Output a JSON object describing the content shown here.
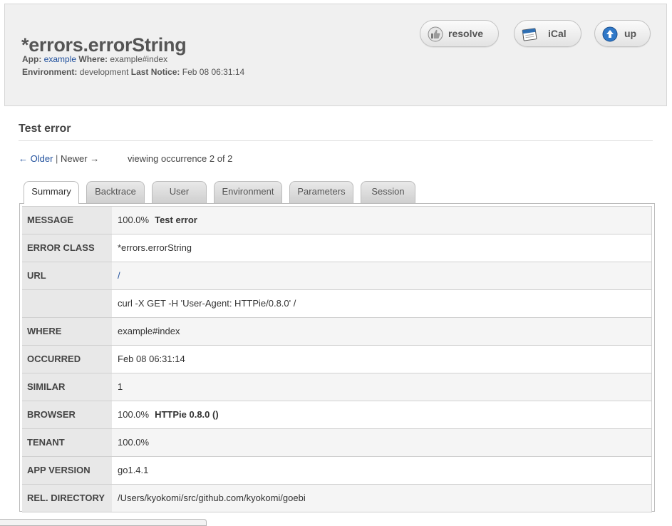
{
  "header": {
    "title": "*errors.errorString",
    "app_label": "App:",
    "app_value": "example",
    "where_label": "Where:",
    "where_value": "example#index",
    "env_label": "Environment:",
    "env_value": "development",
    "last_notice_label": "Last Notice:",
    "last_notice_value": "Feb 08 06:31:14",
    "buttons": {
      "resolve": "resolve",
      "ical": "iCal",
      "up": "up"
    }
  },
  "section_title": "Test error",
  "pager": {
    "older": "← Older",
    "separator": "|",
    "newer": "Newer →",
    "viewing": "viewing occurrence 2 of 2"
  },
  "tabs": [
    "Summary",
    "Backtrace",
    "User",
    "Environment",
    "Parameters",
    "Session"
  ],
  "summary": {
    "message_label": "MESSAGE",
    "message_pct": "100.0%",
    "message_text": "Test error",
    "error_class_label": "ERROR CLASS",
    "error_class_value": "*errors.errorString",
    "url_label": "URL",
    "url_value": "/",
    "curl_value": "curl -X GET -H 'User-Agent: HTTPie/0.8.0' /",
    "where_label": "WHERE",
    "where_value": "example#index",
    "occurred_label": "OCCURRED",
    "occurred_value": "Feb 08 06:31:14",
    "similar_label": "SIMILAR",
    "similar_value": "1",
    "browser_label": "BROWSER",
    "browser_pct": "100.0%",
    "browser_value": "HTTPie 0.8.0 ()",
    "tenant_label": "TENANT",
    "tenant_value": "100.0%",
    "app_version_label": "APP VERSION",
    "app_version_value": "go1.4.1",
    "rel_directory_label": "REL. DIRECTORY",
    "rel_directory_value": "/Users/kyokomi/src/github.com/kyokomi/goebi"
  },
  "status_bar": "",
  "colors": {
    "link": "#1f4f9c",
    "header_bg": "#f0f0f0",
    "label_bg": "#e8e8e8"
  },
  "icons": {
    "resolve": "thumbs-up-icon",
    "ical": "calendar-icon",
    "up": "arrow-up-icon"
  }
}
